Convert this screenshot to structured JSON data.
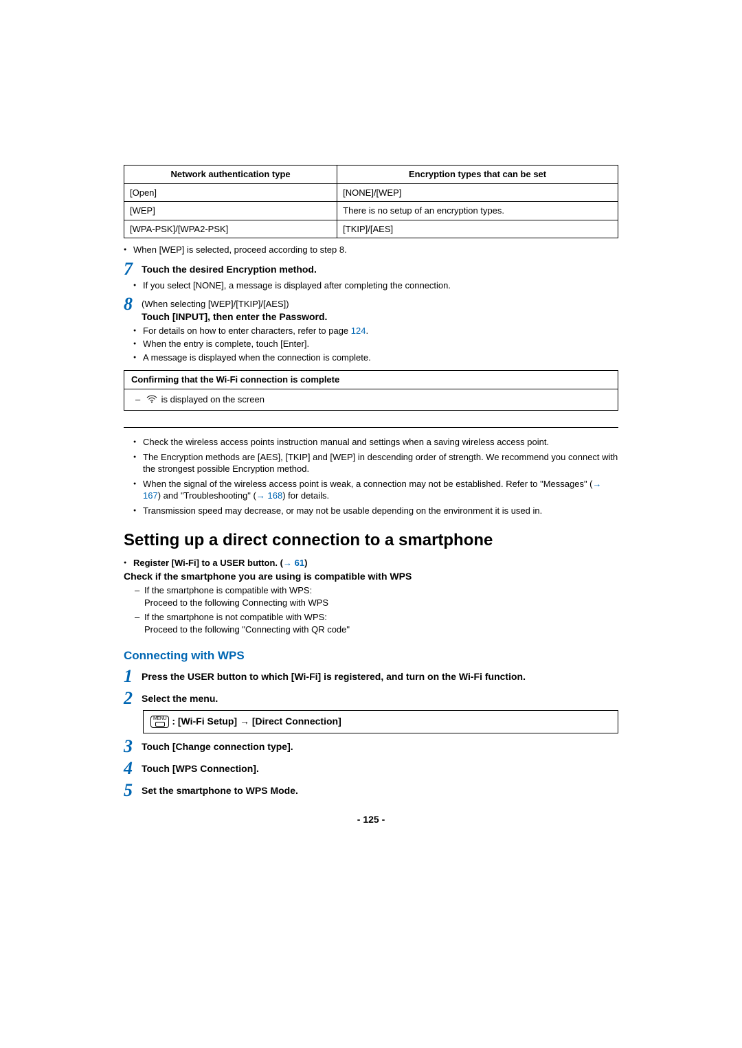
{
  "table": {
    "headers": [
      "Network authentication type",
      "Encryption types that can be set"
    ],
    "rows": [
      [
        "[Open]",
        "[NONE]/[WEP]"
      ],
      [
        "[WEP]",
        "There is no setup of an encryption types."
      ],
      [
        "[WPA-PSK]/[WPA2-PSK]",
        "[TKIP]/[AES]"
      ]
    ]
  },
  "after_table_note": "When [WEP] is selected, proceed according to step 8.",
  "step7": {
    "num": "7",
    "title": "Touch the desired Encryption method.",
    "bullets": [
      "If you select [NONE], a message is displayed after completing the connection."
    ]
  },
  "step8": {
    "num": "8",
    "pre": "(When selecting [WEP]/[TKIP]/[AES])",
    "title": "Touch [INPUT], then enter the Password.",
    "bullets_pre": "For details on how to enter characters, refer to page ",
    "bullets_link": "124",
    "bullets_post": ".",
    "bullet2": "When the entry is complete, touch [Enter].",
    "bullet3": "A message is displayed when the connection is complete."
  },
  "confirm": {
    "header": "Confirming that the Wi-Fi connection is complete",
    "body": " is displayed on the screen"
  },
  "notes": [
    "Check the wireless access points instruction manual and settings when a saving wireless access point.",
    "The Encryption methods are [AES], [TKIP] and [WEP] in descending order of strength. We recommend you connect with the strongest possible Encryption method.",
    {
      "pre": "When the signal of the wireless access point is weak, a connection may not be established. Refer to \"Messages\" (",
      "l1": "→ 167",
      "mid": ") and \"Troubleshooting\" (",
      "l2": "→ 168",
      "post": ") for details."
    },
    "Transmission speed may decrease, or may not be usable depending on the environment it is used in."
  ],
  "section_title": "Setting up a direct connection to a smartphone",
  "register": {
    "pre": "Register [Wi-Fi] to a USER button. (",
    "link": "→ 61",
    "post": ")"
  },
  "check_title": "Check if the smartphone you are using is compatible with WPS",
  "dash": [
    {
      "head": "If the smartphone is compatible with WPS:",
      "body": "Proceed to the following Connecting with WPS"
    },
    {
      "head": "If the smartphone is not compatible with WPS:",
      "body": "Proceed to the following \"Connecting with QR code\""
    }
  ],
  "sub_title": "Connecting with WPS",
  "s1": {
    "num": "1",
    "text": "Press the USER button to which [Wi-Fi] is registered, and turn on the Wi-Fi function."
  },
  "s2": {
    "num": "2",
    "text": "Select the menu."
  },
  "menu": {
    "label": "MENU",
    "path1": ": [Wi-Fi Setup] ",
    "arrow": "→",
    "path2": " [Direct Connection]"
  },
  "s3": {
    "num": "3",
    "text": "Touch [Change connection type]."
  },
  "s4": {
    "num": "4",
    "text": "Touch [WPS Connection]."
  },
  "s5": {
    "num": "5",
    "text": "Set the smartphone to WPS Mode."
  },
  "page": "- 125 -"
}
